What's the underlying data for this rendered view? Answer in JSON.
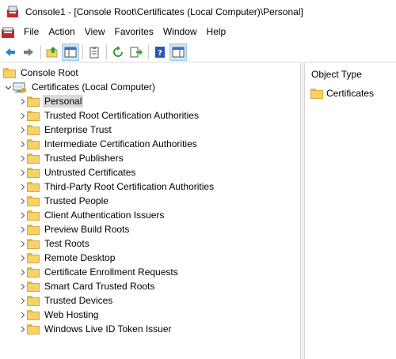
{
  "window": {
    "title": "Console1 - [Console Root\\Certificates (Local Computer)\\Personal]"
  },
  "menu": {
    "items": [
      "File",
      "Action",
      "View",
      "Favorites",
      "Window",
      "Help"
    ]
  },
  "toolbar": {
    "buttons": [
      "back-arrow",
      "forward-arrow",
      "up-folder",
      "show-hide-console-tree",
      "properties",
      "refresh",
      "export-list",
      "help",
      "show-hide-action-pane"
    ]
  },
  "tree": {
    "root_label": "Console Root",
    "snapin_label": "Certificates (Local Computer)",
    "selected": "Personal",
    "stores": [
      "Personal",
      "Trusted Root Certification Authorities",
      "Enterprise Trust",
      "Intermediate Certification Authorities",
      "Trusted Publishers",
      "Untrusted Certificates",
      "Third-Party Root Certification Authorities",
      "Trusted People",
      "Client Authentication Issuers",
      "Preview Build Roots",
      "Test Roots",
      "Remote Desktop",
      "Certificate Enrollment Requests",
      "Smart Card Trusted Roots",
      "Trusted Devices",
      "Web Hosting",
      "Windows Live ID Token Issuer"
    ]
  },
  "details": {
    "column_header": "Object Type",
    "items": [
      "Certificates"
    ]
  },
  "colors": {
    "folder": "#f7d26b",
    "selection": "#d9d9d9",
    "toolbar_pressed": "#cce4f7"
  }
}
